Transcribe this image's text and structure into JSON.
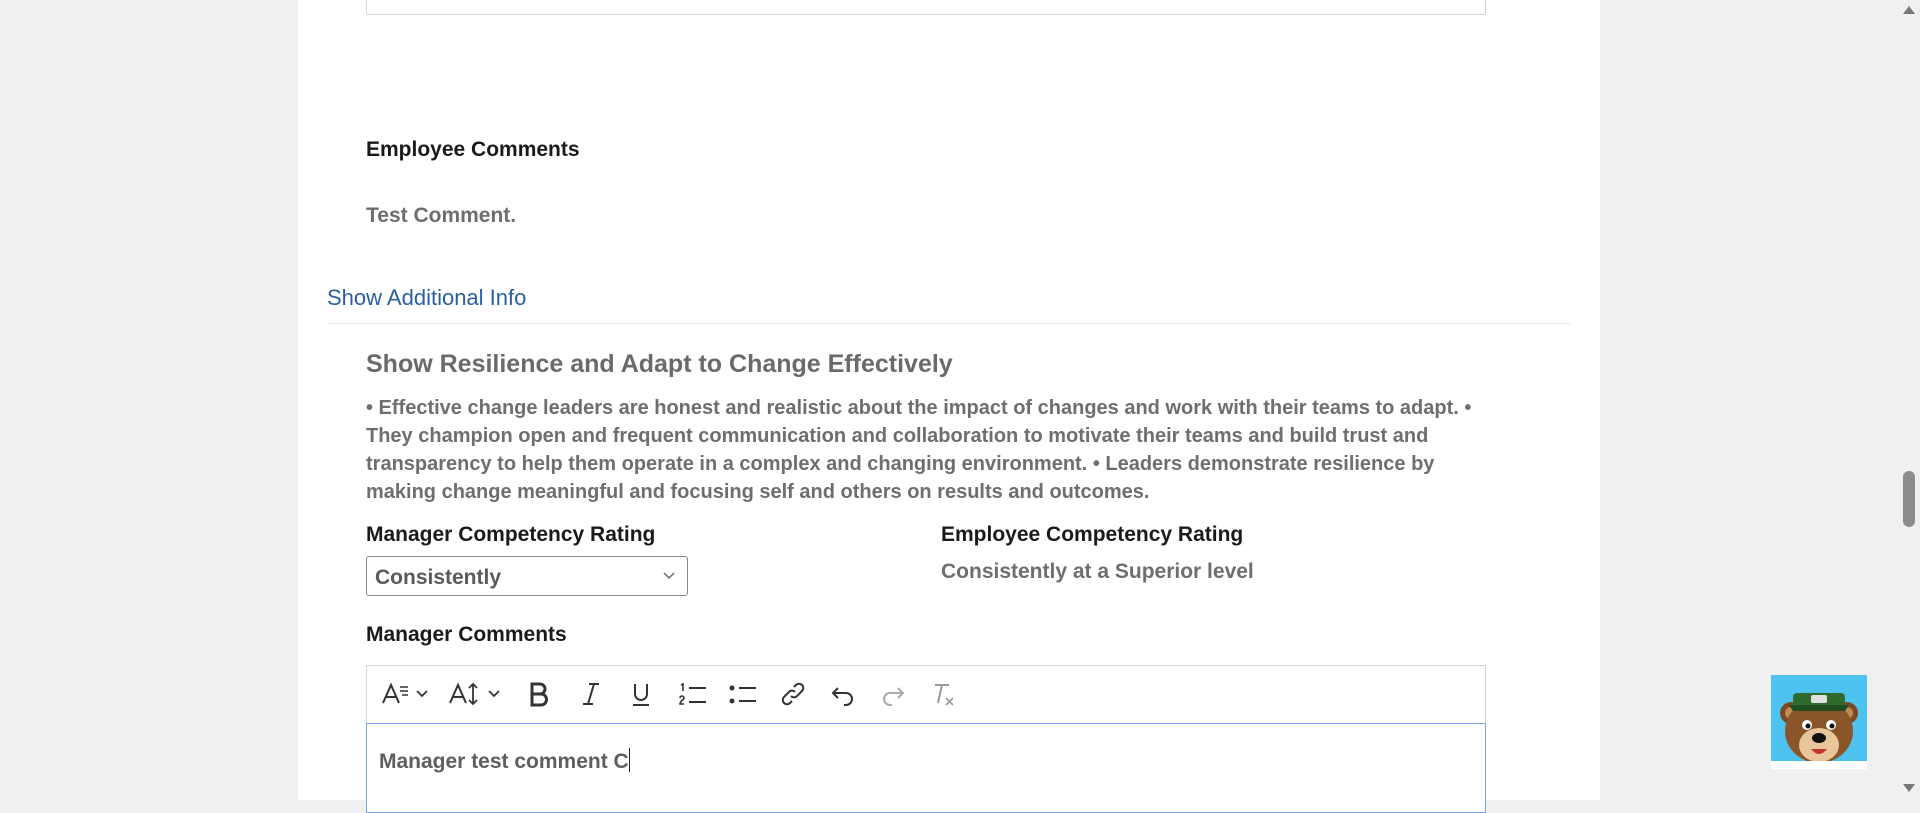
{
  "employee_comments": {
    "label": "Employee Comments",
    "text": "Test Comment."
  },
  "show_additional_info": "Show Additional Info",
  "competency": {
    "title": "Show Resilience and Adapt to Change Effectively",
    "description": "• Effective change leaders are honest and realistic about the impact of changes and work with their teams to adapt. • They champion open and frequent communication and collaboration to motivate their teams and build trust and transparency to help them operate in a complex and changing environment. • Leaders demonstrate resilience by making change meaningful and focusing self and others on results and outcomes."
  },
  "manager_rating": {
    "label": "Manager Competency Rating",
    "selected": "Consistently"
  },
  "employee_rating": {
    "label": "Employee Competency Rating",
    "value": "Consistently at a Superior level"
  },
  "manager_comments": {
    "label": "Manager Comments",
    "value": "Manager test comment C"
  },
  "toolbar": {
    "icons": [
      "font-family-icon",
      "font-size-icon",
      "bold-icon",
      "italic-icon",
      "underline-icon",
      "ordered-list-icon",
      "bullet-list-icon",
      "link-icon",
      "undo-icon",
      "redo-icon",
      "clear-format-icon"
    ]
  },
  "colors": {
    "link": "#2b5fa0",
    "editor_focus": "#7aa6e8",
    "mascot_bg": "#4fc3ef"
  }
}
